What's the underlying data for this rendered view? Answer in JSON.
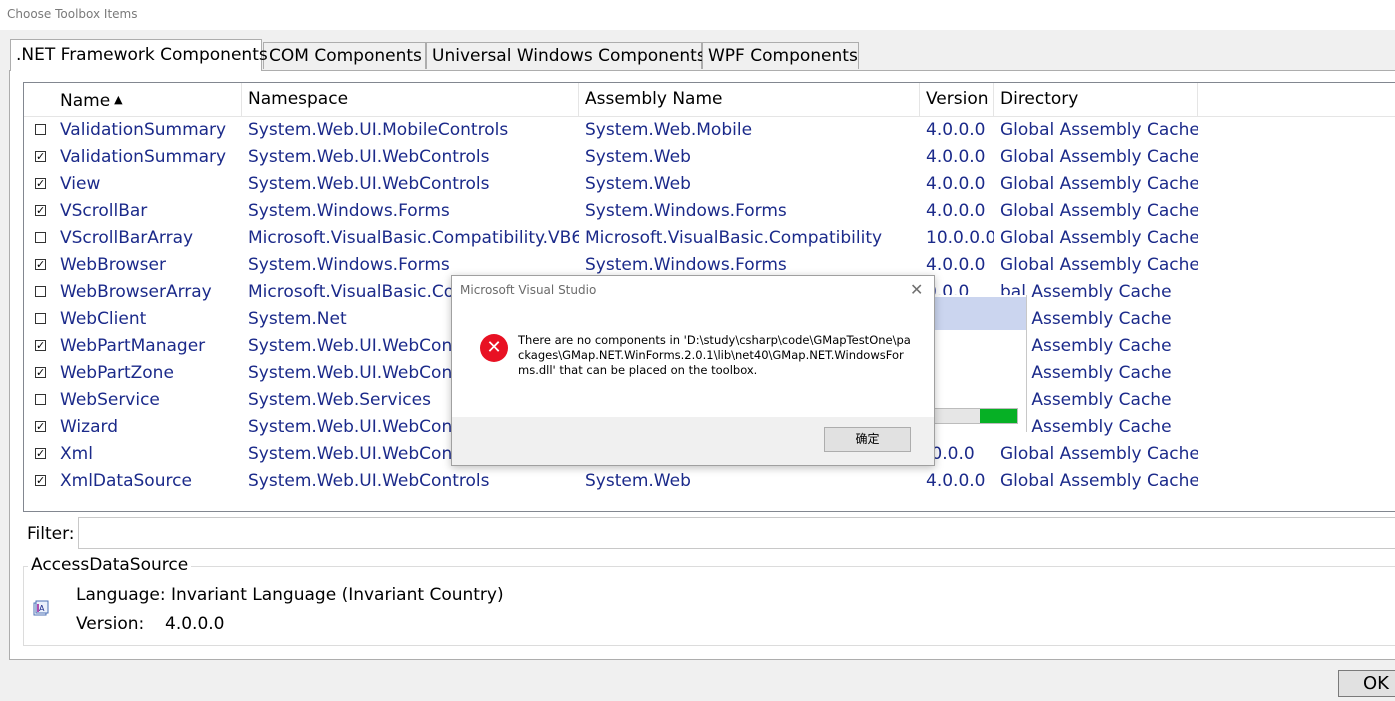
{
  "window": {
    "title": "Choose Toolbox Items"
  },
  "tabs": [
    {
      "label": ".NET Framework Components",
      "active": true
    },
    {
      "label": "COM Components"
    },
    {
      "label": "Universal Windows Components"
    },
    {
      "label": "WPF Components"
    }
  ],
  "list": {
    "columns": [
      "Name",
      "Namespace",
      "Assembly Name",
      "Version",
      "Directory"
    ],
    "sorted_column": "Name",
    "sort_icon": "sort-ascending-icon",
    "rows": [
      {
        "checked": false,
        "name": "ValidationSummary",
        "namespace": "System.Web.UI.MobileControls",
        "assembly": "System.Web.Mobile",
        "version": "4.0.0.0",
        "directory": "Global Assembly Cache"
      },
      {
        "checked": true,
        "name": "ValidationSummary",
        "namespace": "System.Web.UI.WebControls",
        "assembly": "System.Web",
        "version": "4.0.0.0",
        "directory": "Global Assembly Cache"
      },
      {
        "checked": true,
        "name": "View",
        "namespace": "System.Web.UI.WebControls",
        "assembly": "System.Web",
        "version": "4.0.0.0",
        "directory": "Global Assembly Cache"
      },
      {
        "checked": true,
        "name": "VScrollBar",
        "namespace": "System.Windows.Forms",
        "assembly": "System.Windows.Forms",
        "version": "4.0.0.0",
        "directory": "Global Assembly Cache"
      },
      {
        "checked": false,
        "name": "VScrollBarArray",
        "namespace": "Microsoft.VisualBasic.Compatibility.VB6",
        "assembly": "Microsoft.VisualBasic.Compatibility",
        "version": "10.0.0.0",
        "directory": "Global Assembly Cache"
      },
      {
        "checked": true,
        "name": "WebBrowser",
        "namespace": "System.Windows.Forms",
        "assembly": "System.Windows.Forms",
        "version": "4.0.0.0",
        "directory": "Global Assembly Cache"
      },
      {
        "checked": false,
        "name": "WebBrowserArray",
        "namespace": "Microsoft.VisualBasic.Con",
        "assembly": "",
        "version": "0.0.0",
        "directory": "bal Assembly Cache"
      },
      {
        "checked": false,
        "name": "WebClient",
        "namespace": "System.Net",
        "assembly": "",
        "version": "",
        "directory": "bal Assembly Cache"
      },
      {
        "checked": true,
        "name": "WebPartManager",
        "namespace": "System.Web.UI.WebCont",
        "assembly": "",
        "version": "",
        "directory": "bal Assembly Cache"
      },
      {
        "checked": true,
        "name": "WebPartZone",
        "namespace": "System.Web.UI.WebCont",
        "assembly": "",
        "version": "",
        "directory": "bal Assembly Cache"
      },
      {
        "checked": false,
        "name": "WebService",
        "namespace": "System.Web.Services",
        "assembly": "",
        "version": "",
        "directory": "bal Assembly Cache"
      },
      {
        "checked": true,
        "name": "Wizard",
        "namespace": "System.Web.UI.WebCont",
        "assembly": "",
        "version": "",
        "directory": "bal Assembly Cache"
      },
      {
        "checked": true,
        "name": "Xml",
        "namespace": "System.Web.UI.WebCont",
        "assembly": "",
        "version": ".0.0.0",
        "directory": "Global Assembly Cache"
      },
      {
        "checked": true,
        "name": "XmlDataSource",
        "namespace": "System.Web.UI.WebControls",
        "assembly": "System.Web",
        "version": "4.0.0.0",
        "directory": "Global Assembly Cache"
      }
    ]
  },
  "filter": {
    "label": "Filter:",
    "value": ""
  },
  "details": {
    "group_title": "AccessDataSource",
    "icon": "component-icon",
    "language_label": "Language:",
    "language_value": "Invariant Language (Invariant Country)",
    "version_label": "Version:",
    "version_value": "4.0.0.0"
  },
  "ok_button": "OK",
  "dialog": {
    "title": "Microsoft Visual Studio",
    "close_icon": "close-icon",
    "icon": "error-icon",
    "message": "There are no components in 'D:\\study\\csharp\\code\\GMapTestOne\\packages\\GMap.NET.WinForms.2.0.1\\lib\\net40\\GMap.NET.WindowsForms.dll' that can be placed on the toolbox.",
    "ok_label": "确定"
  },
  "background_progress": {
    "fill_fraction": 0.45,
    "color": "#06b025"
  }
}
